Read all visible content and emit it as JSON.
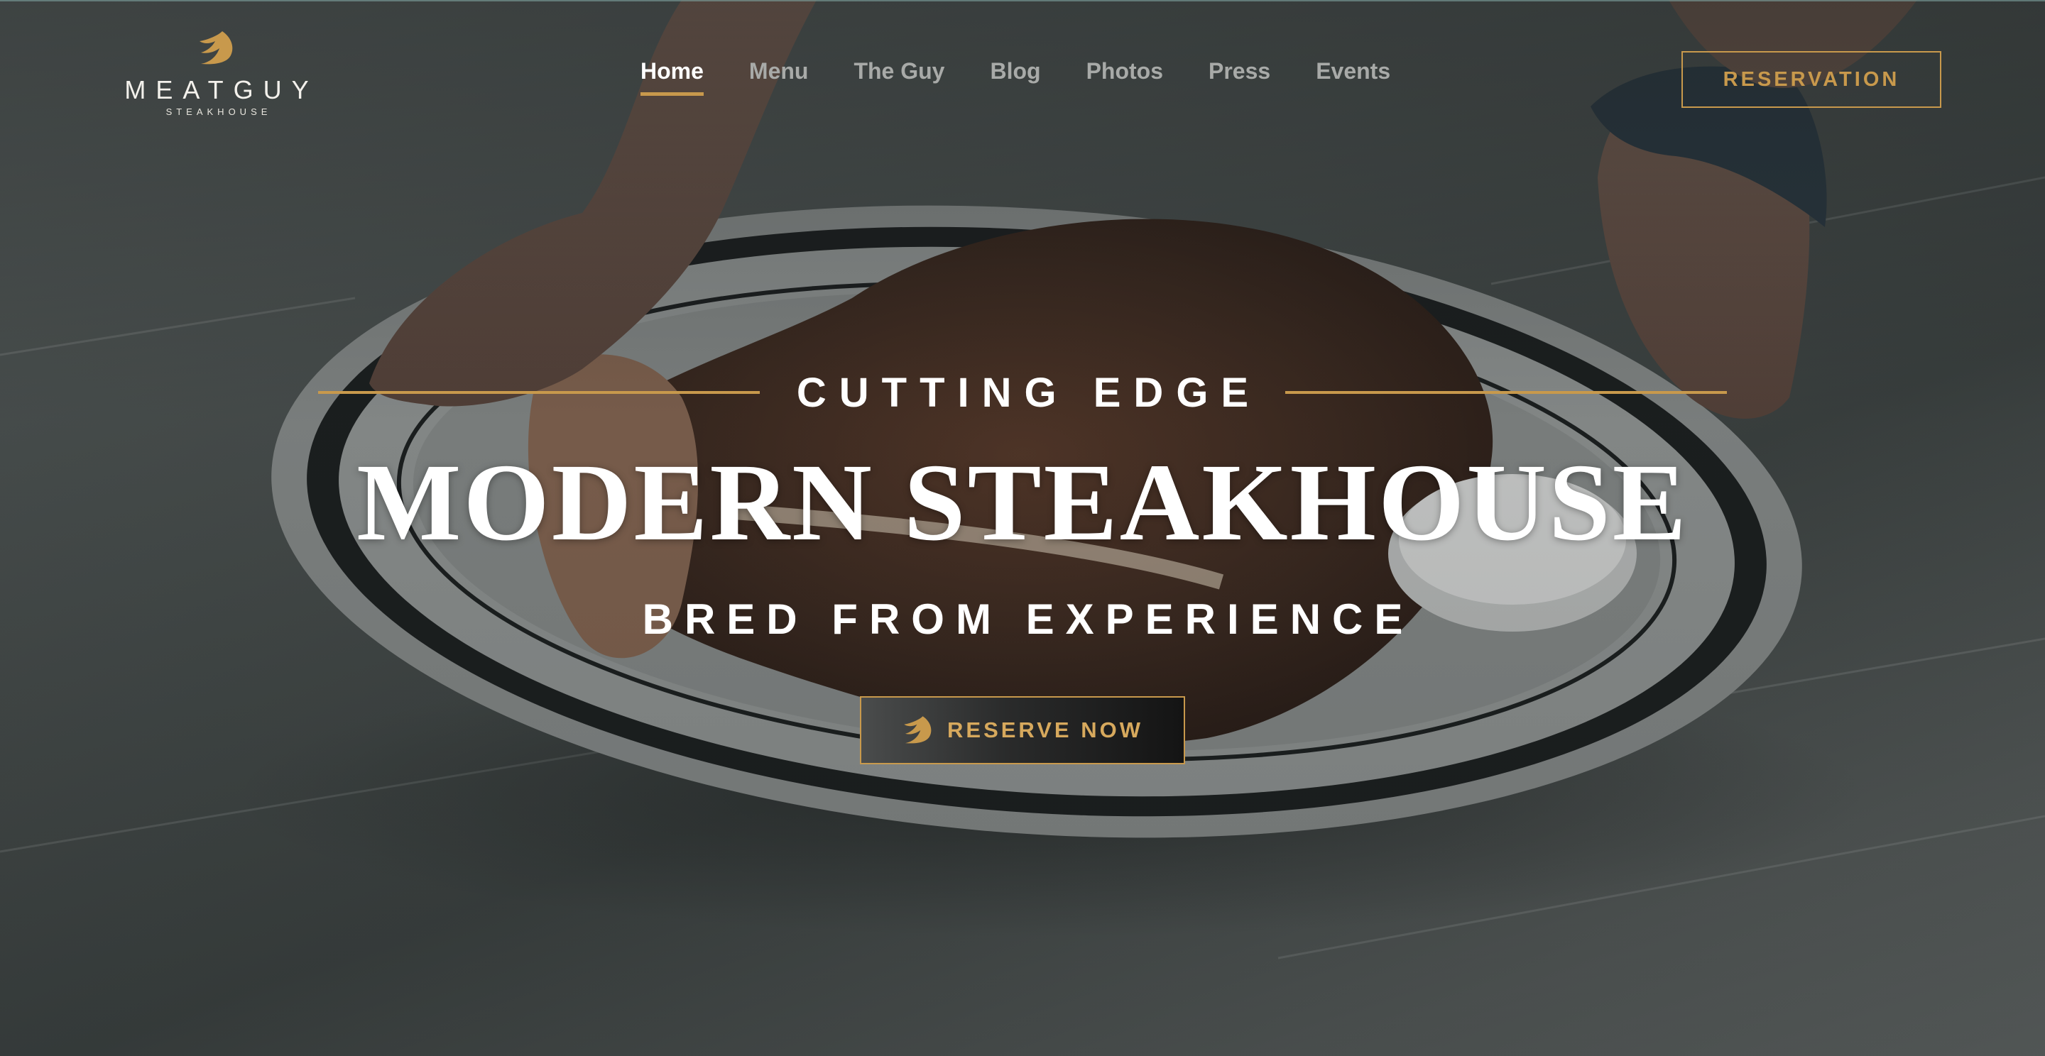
{
  "brand": {
    "name": "MEATGUY",
    "tagline": "STEAKHOUSE",
    "logo_icon": "flame-wing-icon",
    "accent_color": "#c8994c"
  },
  "nav": {
    "items": [
      {
        "label": "Home",
        "active": true
      },
      {
        "label": "Menu",
        "active": false
      },
      {
        "label": "The Guy",
        "active": false
      },
      {
        "label": "Blog",
        "active": false
      },
      {
        "label": "Photos",
        "active": false
      },
      {
        "label": "Press",
        "active": false
      },
      {
        "label": "Events",
        "active": false
      }
    ]
  },
  "header": {
    "reservation_label": "RESERVATION"
  },
  "hero": {
    "eyebrow": "CUTTING EDGE",
    "headline": "MODERN STEAKHOUSE",
    "subline": "BRED FROM EXPERIENCE",
    "cta_label": "RESERVE NOW",
    "cta_icon": "flame-wing-icon",
    "background_image": "steak-on-plate-photo"
  }
}
